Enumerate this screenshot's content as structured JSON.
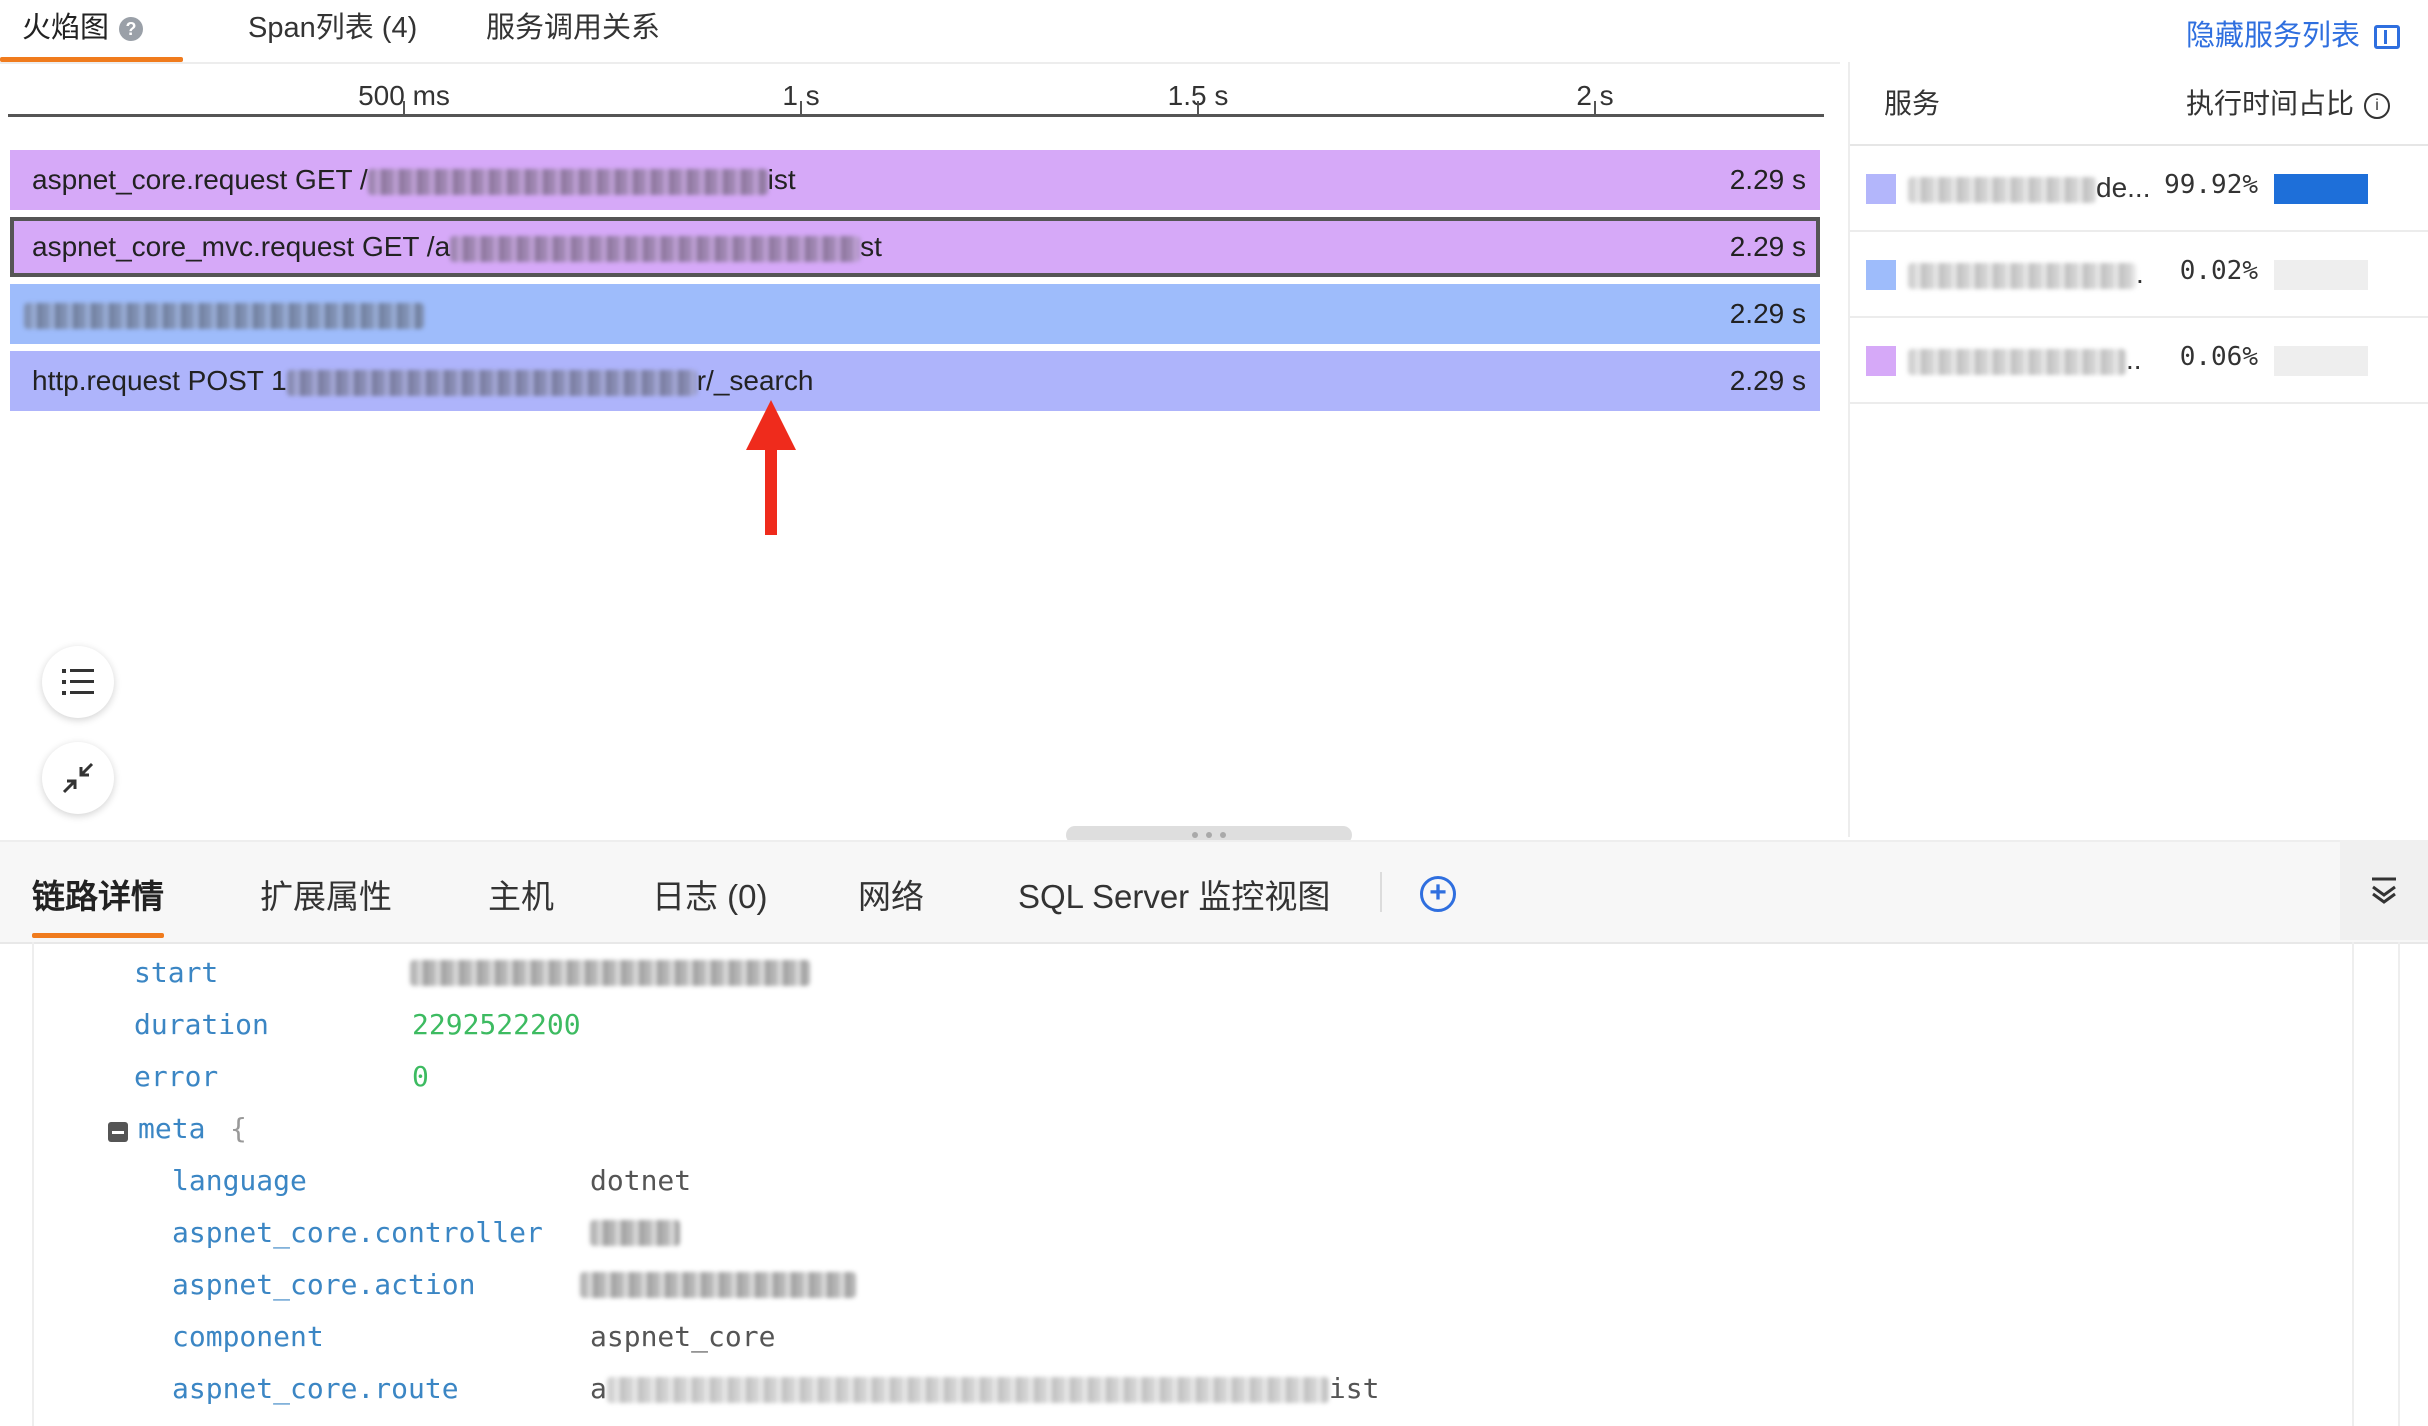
{
  "top_tabs": {
    "flame": "火焰图",
    "span_list": "Span列表 (4)",
    "service_calls": "服务调用关系",
    "hide_services": "隐藏服务列表"
  },
  "axis": {
    "ticks": [
      "500 ms",
      "1 s",
      "1.5 s",
      "2 s"
    ]
  },
  "spans": [
    {
      "prefix": "aspnet_core.request GET /",
      "suffix": "ist",
      "duration": "2.29 s",
      "color": "#d6a9f8"
    },
    {
      "prefix": "aspnet_core_mvc.request GET /a",
      "suffix": "st",
      "duration": "2.29 s",
      "color": "#d6a9f8",
      "selected": true
    },
    {
      "prefix": "",
      "suffix": "",
      "duration": "2.29 s",
      "color": "#9ebcfb"
    },
    {
      "prefix": "http.request POST 1",
      "suffix": "r/_search",
      "duration": "2.29 s",
      "color": "#aeb4fb"
    }
  ],
  "services": {
    "header_service": "服务",
    "header_ratio": "执行时间占比",
    "rows": [
      {
        "name_suffix": "de...",
        "pct": "99.92%",
        "color": "#b3b6fb",
        "ratio": 0.9992
      },
      {
        "name_suffix": ".",
        "pct": "0.02%",
        "color": "#9ebcfb",
        "ratio": 0.0002
      },
      {
        "name_suffix": "..",
        "pct": "0.06%",
        "color": "#d6a9f8",
        "ratio": 0.0006
      }
    ]
  },
  "bottom_tabs": {
    "trace_details": "链路详情",
    "ext_attrs": "扩展属性",
    "host": "主机",
    "logs": "日志 (0)",
    "network": "网络",
    "sql_server": "SQL Server 监控视图"
  },
  "details": {
    "start_key": "start",
    "duration_key": "duration",
    "duration_val": "2292522200",
    "error_key": "error",
    "error_val": "0",
    "meta_key": "meta",
    "meta_brace": "{",
    "language_key": "language",
    "language_val": "dotnet",
    "controller_key": "aspnet_core.controller",
    "action_key": "aspnet_core.action",
    "component_key": "component",
    "component_val": "aspnet_core",
    "route_key": "aspnet_core.route",
    "route_prefix": "a",
    "route_suffix": "ist"
  },
  "colors": {
    "accent_tab": "#f07b1d",
    "link_blue": "#2f6fdf",
    "arrow_red": "#ef2b1c",
    "key_blue": "#3b86c4",
    "number_green": "#3dbb61"
  }
}
